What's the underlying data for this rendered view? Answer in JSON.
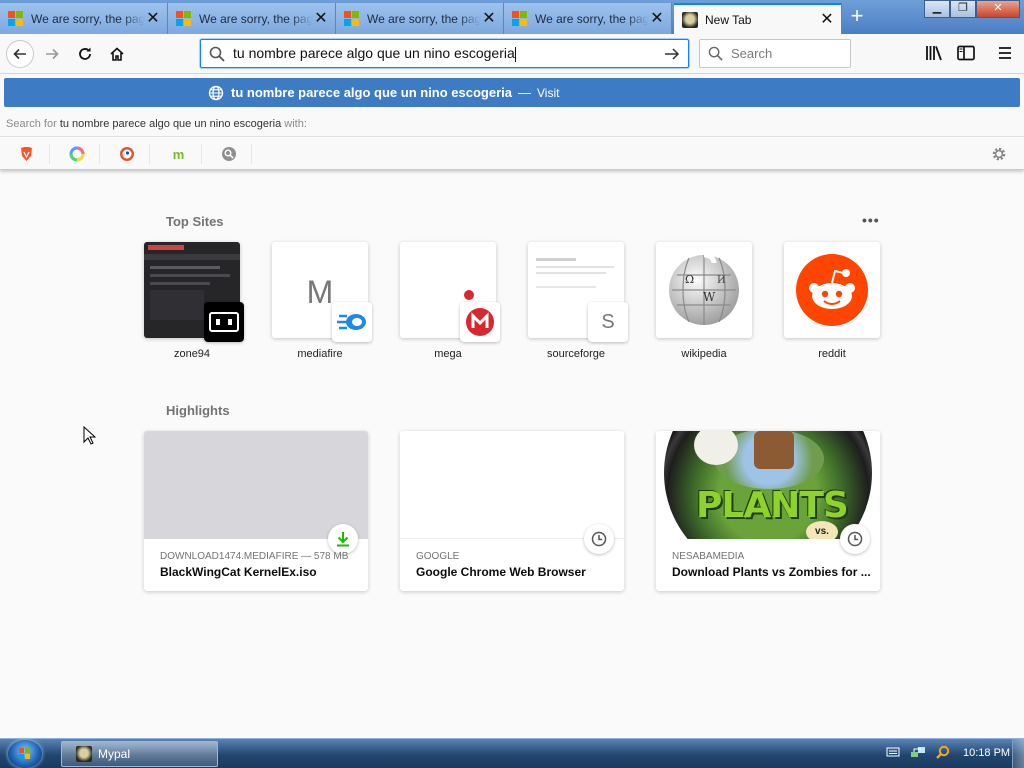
{
  "window": {
    "controls": {
      "minimize": "▁",
      "maximize": "❐",
      "close": "✕"
    },
    "tabs": [
      {
        "title": "We are sorry, the page you requested cannot be found",
        "icon": "microsoft-icon"
      },
      {
        "title": "We are sorry, the page you requested cannot be found",
        "icon": "microsoft-icon"
      },
      {
        "title": "We are sorry, the page you requested cannot be found",
        "icon": "microsoft-icon"
      },
      {
        "title": "We are sorry, the page you requested cannot be found",
        "icon": "microsoft-icon"
      },
      {
        "title": "New Tab",
        "icon": "mypal-icon",
        "active": true
      }
    ],
    "new_tab_label": "+"
  },
  "toolbar": {
    "url": "tu nombre parece algo que un nino escogeria",
    "search_placeholder": "Search"
  },
  "dropdown": {
    "suggestion_text": "tu nombre parece algo que un nino escogeria",
    "suggestion_sep": "—",
    "suggestion_action": "Visit",
    "search_for_prefix": "Search for",
    "search_for_query": "tu nombre parece algo que un nino escogeria",
    "search_for_suffix": "with:",
    "engines": [
      "brave-icon",
      "qwant-icon",
      "duckduckgo-icon",
      "mojeek-icon",
      "search-engine-icon"
    ]
  },
  "newtab": {
    "top_sites_title": "Top Sites",
    "top_sites_menu": "•••",
    "top_sites": [
      {
        "label": "zone94"
      },
      {
        "label": "mediafire",
        "letter": "M"
      },
      {
        "label": "mega"
      },
      {
        "label": "sourceforge",
        "letter": "S"
      },
      {
        "label": "wikipedia"
      },
      {
        "label": "reddit"
      }
    ],
    "highlights_title": "Highlights",
    "highlights": [
      {
        "source": "DOWNLOAD1474.MEDIAFIRE — 578 MB",
        "title": "BlackWingCat KernelEx.iso",
        "badge": "download-icon"
      },
      {
        "source": "GOOGLE",
        "title": "Google Chrome Web Browser",
        "badge": "history-icon"
      },
      {
        "source": "NESABAMEDIA",
        "title": "Download Plants vs Zombies for ...",
        "badge": "history-icon",
        "thumb_text": "PLANTS",
        "thumb_sub": "vs."
      }
    ]
  },
  "taskbar": {
    "app_label": "Mypal",
    "clock": "10:18 PM"
  },
  "colors": {
    "accent": "#0a84ff",
    "suggestion": "#3d7cc4",
    "reddit": "#ff4500",
    "mega": "#d9272e",
    "mediafire": "#1e88e5"
  }
}
